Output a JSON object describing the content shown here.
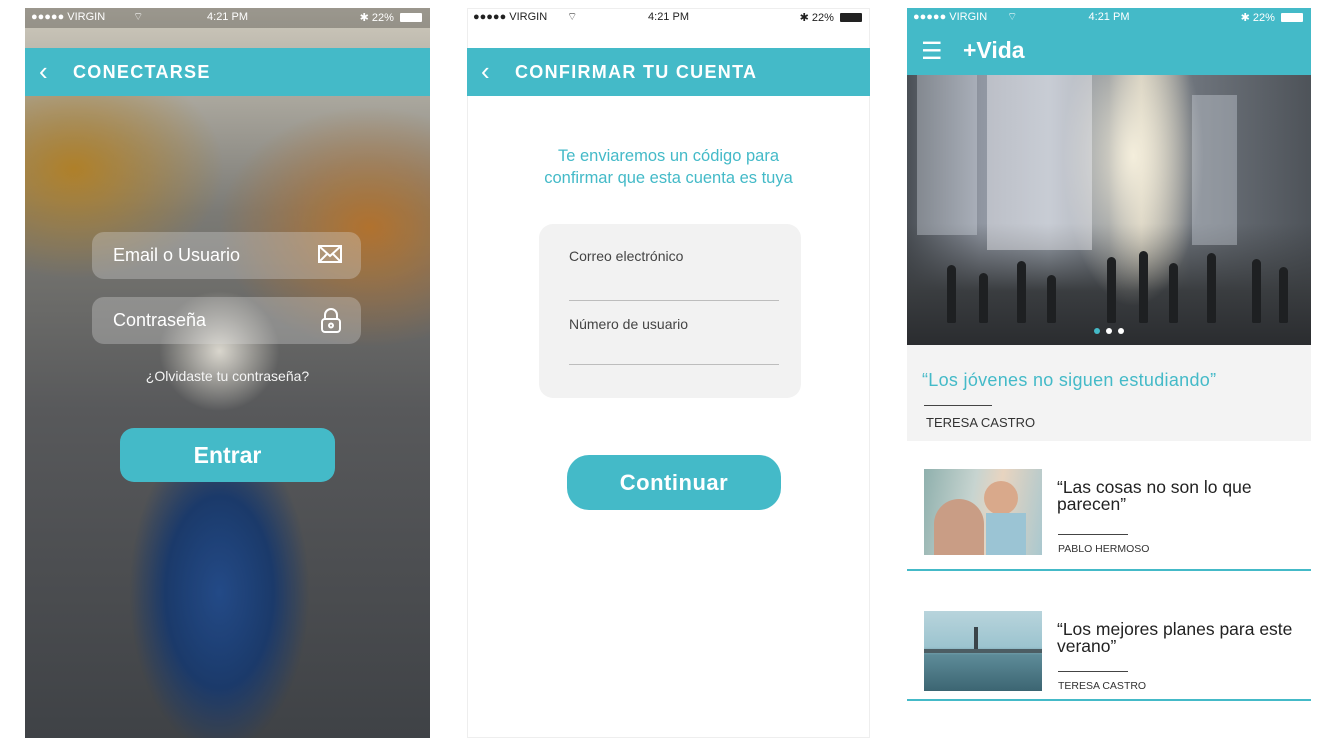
{
  "status": {
    "carrier": "●●●●● VIRGIN",
    "time": "4:21 PM",
    "battery": "22%"
  },
  "icons": {
    "wifi": "wifi-icon",
    "bluetooth": "bluetooth-icon",
    "back": "chevron-left-icon",
    "email": "envelope-icon",
    "password": "lock-icon",
    "menu": "hamburger-menu-icon"
  },
  "login": {
    "nav_title": "CONECTARSE",
    "email_placeholder": "Email o Usuario",
    "password_placeholder": "Contraseña",
    "forgot": "¿Olvidaste tu contraseña?",
    "submit": "Entrar"
  },
  "confirm": {
    "nav_title": "CONFIRMAR TU CUENTA",
    "intro_line1": "Te enviaremos un código para",
    "intro_line2": "confirmar que esta cuenta es tuya",
    "email_label": "Correo electrónico",
    "user_label": "Número de usuario",
    "submit": "Continuar"
  },
  "feed": {
    "brand": "+Vida",
    "carousel": {
      "slides": 3,
      "active": 1
    },
    "featured": {
      "title": "“Los jóvenes no siguen estudiando”",
      "author": "TERESA CASTRO"
    },
    "articles": [
      {
        "title": "“Las cosas no son lo que parecen”",
        "author": "PABLO HERMOSO"
      },
      {
        "title": "“Los mejores planes para este verano”",
        "author": "TERESA CASTRO"
      }
    ]
  },
  "colors": {
    "accent": "#44bac8",
    "card": "#f2f2f2",
    "text_dark": "#222222"
  }
}
